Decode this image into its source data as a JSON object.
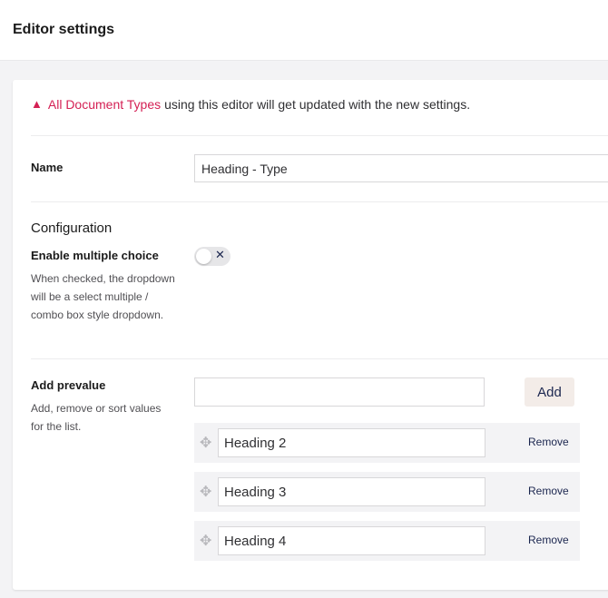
{
  "header": {
    "title": "Editor settings"
  },
  "warning": {
    "link_text": "All Document Types",
    "message": "using this editor will get updated with the new settings.",
    "accent_color": "#d42054"
  },
  "name_field": {
    "label": "Name",
    "value": "Heading - Type"
  },
  "configuration": {
    "title": "Configuration",
    "multiple_choice": {
      "label": "Enable multiple choice",
      "description": "When checked, the dropdown will be a select multiple / combo box style dropdown.",
      "enabled": false
    }
  },
  "prevalues": {
    "label": "Add prevalue",
    "description": "Add, remove or sort values for the list.",
    "new_value": "",
    "add_label": "Add",
    "remove_label": "Remove",
    "items": [
      {
        "value": "Heading 2"
      },
      {
        "value": "Heading 3"
      },
      {
        "value": "Heading 4"
      }
    ]
  }
}
